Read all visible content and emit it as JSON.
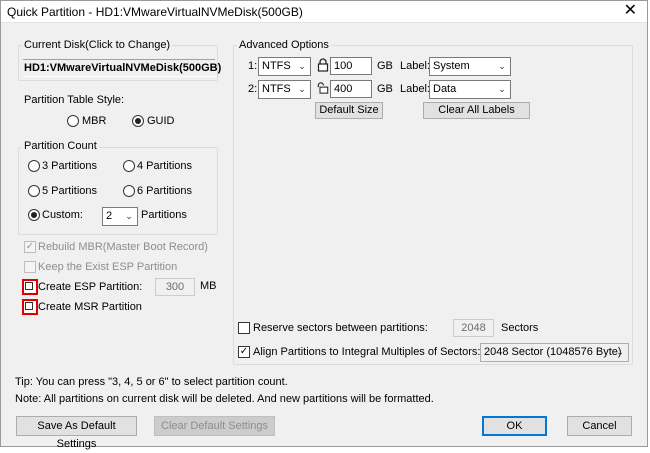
{
  "window": {
    "title": "Quick Partition - HD1:VMwareVirtualNVMeDisk(500GB)",
    "close_glyph": "✕"
  },
  "current_disk": {
    "legend": "Current Disk(Click to Change)",
    "value": "HD1:VMwareVirtualNVMeDisk(500GB)"
  },
  "partition_table": {
    "label": "Partition Table Style:",
    "options": [
      "MBR",
      "GUID"
    ],
    "selected": "GUID"
  },
  "partition_count": {
    "legend": "Partition Count",
    "options": [
      "3 Partitions",
      "4 Partitions",
      "5 Partitions",
      "6 Partitions"
    ],
    "custom_label": "Custom:",
    "custom_value": "2",
    "custom_suffix": "Partitions",
    "selected": "Custom:"
  },
  "options": {
    "rebuild_mbr": "Rebuild MBR(Master Boot Record)",
    "keep_esp": "Keep the Exist ESP Partition",
    "create_esp": "Create ESP Partition:",
    "esp_size": "300",
    "esp_unit": "MB",
    "create_msr": "Create MSR Partition"
  },
  "advanced": {
    "legend": "Advanced Options",
    "rows": [
      {
        "index": "1:",
        "fs": "NTFS",
        "size": "100",
        "unit": "GB",
        "label_caption": "Label:",
        "label": "System"
      },
      {
        "index": "2:",
        "fs": "NTFS",
        "size": "400",
        "unit": "GB",
        "label_caption": "Label:",
        "label": "Data"
      }
    ],
    "default_size": "Default Size",
    "clear_labels": "Clear All Labels"
  },
  "reserve": {
    "label": "Reserve sectors between partitions:",
    "value": "2048",
    "unit": "Sectors"
  },
  "align": {
    "label": "Align Partitions to Integral Multiples of Sectors:",
    "value": "2048 Sector (1048576 Byte)"
  },
  "tips": {
    "line1": "Tip:  You can press \"3, 4, 5 or 6\" to select partition count.",
    "line2": "Note: All partitions on current disk will be deleted. And new partitions will be formatted."
  },
  "footer": {
    "save_default": "Save As Default Settings",
    "clear_default": "Clear Default Settings",
    "ok": "OK",
    "cancel": "Cancel"
  }
}
